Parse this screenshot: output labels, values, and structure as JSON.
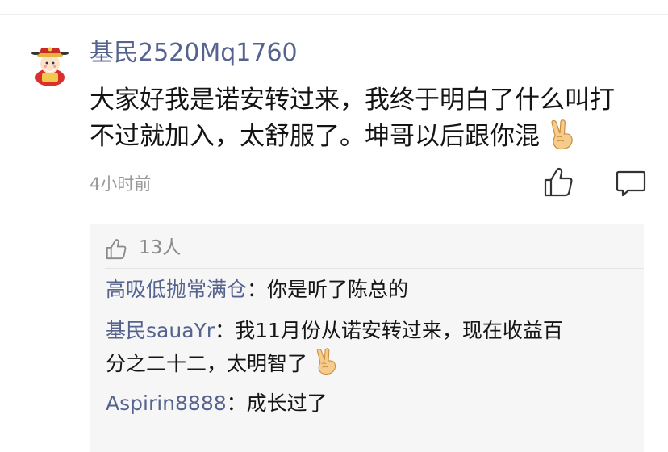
{
  "comment": {
    "username": "基民2520Mq1760",
    "text_line1": "大家好我是诺安转过来，我终于明白了什么叫打",
    "text_line2": "不过就加入，太舒服了。坤哥以后跟你混",
    "timestamp": "4小时前",
    "avatar_icon": "fortune-god-avatar",
    "emoji": "victory-hand",
    "actions": {
      "like_icon": "thumbs-up-icon",
      "reply_icon": "comment-bubble-icon"
    }
  },
  "replies": {
    "like_count": "13人",
    "items": [
      {
        "name": "高吸低抛常满仓",
        "sep": "：",
        "text": "你是听了陈总的"
      },
      {
        "name": "基民sauaYr",
        "sep": "：",
        "text": "我11月份从诺安转过来，现在收益百",
        "text_cont": "分之二十二，太明智了"
      },
      {
        "name": "Aspirin8888",
        "sep": "：",
        "text": "成长过了"
      }
    ]
  },
  "colors": {
    "username": "#56638f",
    "text": "#141414",
    "muted": "#9a9a9a",
    "reply_bg": "#f6f6f6"
  }
}
